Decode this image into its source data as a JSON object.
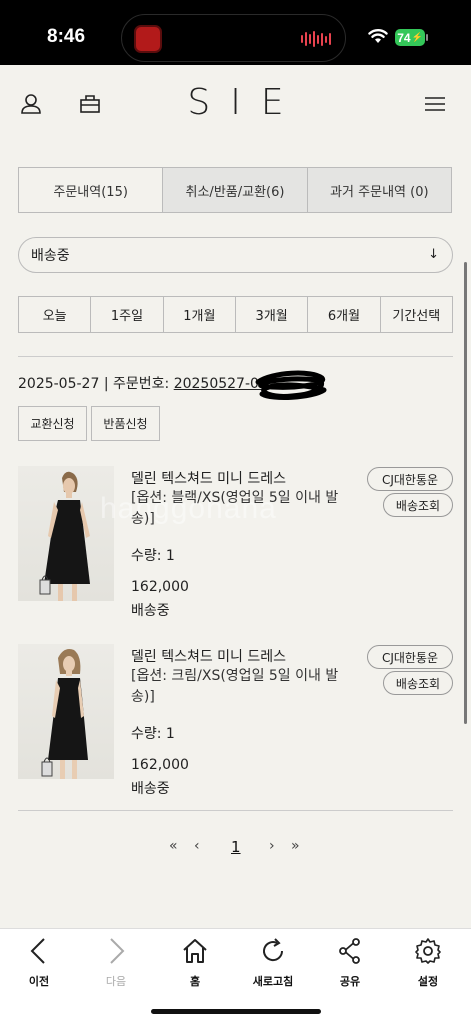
{
  "status_bar": {
    "time": "8:46",
    "battery": "74"
  },
  "header": {
    "logo": "SIE"
  },
  "tabs": [
    {
      "label": "주문내역(15)"
    },
    {
      "label": "취소/반품/교환(6)"
    },
    {
      "label": "과거 주문내역 (0)"
    }
  ],
  "filter": {
    "selected": "배송중"
  },
  "periods": [
    {
      "label": "오늘"
    },
    {
      "label": "1주일"
    },
    {
      "label": "1개월"
    },
    {
      "label": "3개월"
    },
    {
      "label": "6개월"
    },
    {
      "label": "기간선택"
    }
  ],
  "order": {
    "date": "2025-05-27",
    "separator": " | ",
    "order_no_label": "주문번호: ",
    "order_no": "20250527-00",
    "exchange_label": "교환신청",
    "return_label": "반품신청"
  },
  "items": [
    {
      "name": "델린 텍스쳐드 미니 드레스",
      "option": "[옵션: 블랙/XS(영업일 5일 이내 발송)]",
      "qty": "수량: 1",
      "price": "162,000",
      "status": "배송중",
      "courier": "CJ대한통운",
      "track_label": "배송조회",
      "dress_color": "#151515"
    },
    {
      "name": "델린 텍스쳐드 미니 드레스",
      "option": "[옵션: 크림/XS(영업일 5일 이내 발송)]",
      "qty": "수량: 1",
      "price": "162,000",
      "status": "배송중",
      "courier": "CJ대한통운",
      "track_label": "배송조회",
      "dress_color": "#151515"
    }
  ],
  "watermark": "hanggohana",
  "pagination": {
    "current": "1"
  },
  "bottom_nav": [
    {
      "label": "이전",
      "icon": "chevron-left-icon"
    },
    {
      "label": "다음",
      "icon": "chevron-right-icon"
    },
    {
      "label": "홈",
      "icon": "home-icon"
    },
    {
      "label": "새로고침",
      "icon": "refresh-icon"
    },
    {
      "label": "공유",
      "icon": "share-icon"
    },
    {
      "label": "설정",
      "icon": "gear-icon"
    }
  ]
}
